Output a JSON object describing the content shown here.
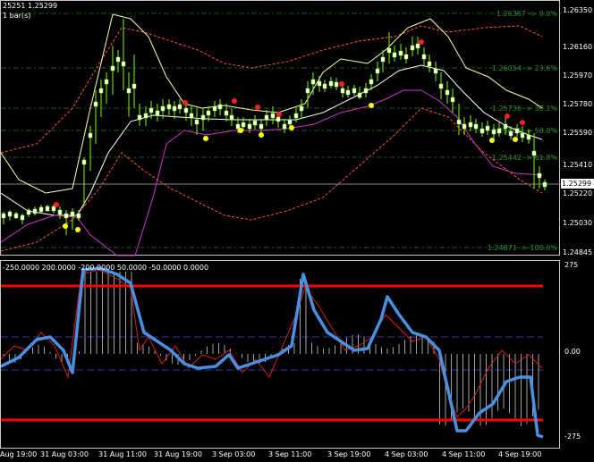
{
  "header": {
    "price_info": "25251 1.25299",
    "bar_info": "1 bar(s)"
  },
  "indicator_header": "-250.0000 200.0000 -200.0000 50.0000 -50.0000 0.0000",
  "price_axis": [
    "1.26350",
    "1.26160",
    "1.25970",
    "1.25780",
    "1.25590",
    "1.25410",
    "1.25220",
    "1.25030",
    "1.24845"
  ],
  "current_price": "1.25299",
  "indicator_axis": [
    "275",
    "0.00",
    "-275"
  ],
  "time_axis": [
    "Aug 19:00",
    "31 Aug 03:00",
    "31 Aug 11:00",
    "31 Aug 19:00",
    "3 Sep 03:00",
    "3 Sep 11:00",
    "3 Sep 19:00",
    "4 Sep 03:00",
    "4 Sep 11:00",
    "4 Sep 19:00"
  ],
  "fib_levels": [
    {
      "label": "1.26367 -> 0.0%"
    },
    {
      "label": "1.26054 -> 23.6%"
    },
    {
      "label": "1.25736 -> 38.2%"
    },
    {
      "label": "1.25600 -> 50.0%"
    },
    {
      "label": "1.25442 -> 61.8%"
    },
    {
      "label": "1.24871 -> 100.0%"
    }
  ],
  "colors": {
    "background": "#000000",
    "candles": "#7cfc00",
    "candle_body_up": "#ffffff",
    "bollinger_outer": "#ffffaa",
    "envelope_dashed": "#ff5050",
    "magenta_line": "#cc33cc",
    "fib_lines": "#1a5c1a",
    "fib_text": "#2e8b2e",
    "cci_line": "#4a90e2",
    "signal_line": "#cc2222",
    "levels_red": "#ff0000",
    "level_dashed": "#3333aa",
    "dot_red": "#ff2020",
    "dot_yellow": "#ffff00"
  }
}
